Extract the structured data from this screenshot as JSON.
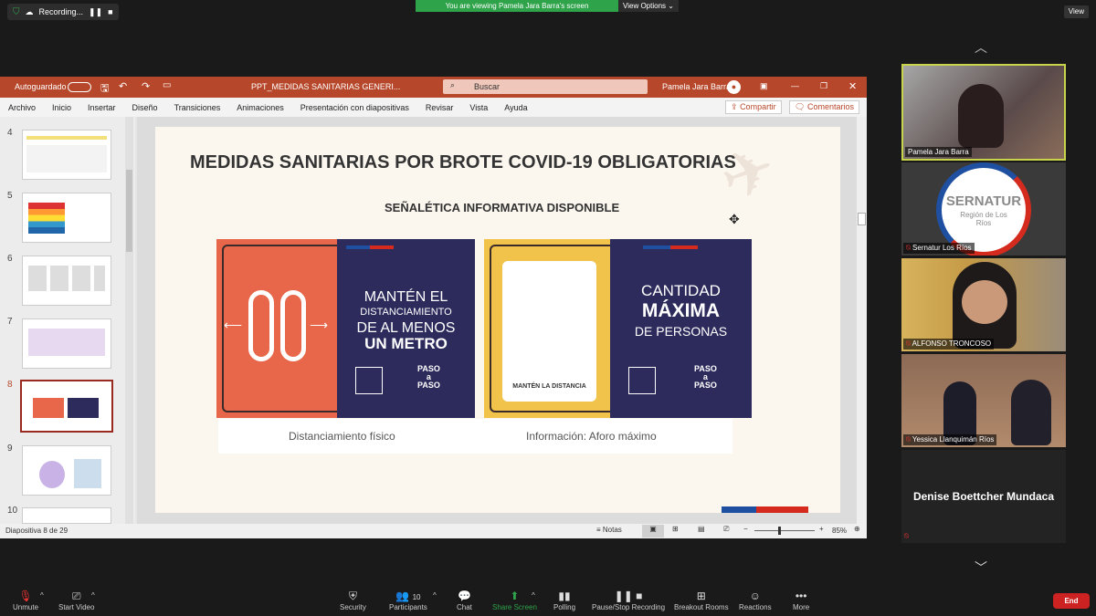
{
  "top": {
    "recording_label": "Recording...",
    "banner_text": "You are viewing Pamela Jara Barra's screen",
    "view_options_label": "View Options ⌄",
    "view_button_label": "View"
  },
  "ppt": {
    "autosave_label": "Autoguardado",
    "file_title": "PPT_MEDIDAS SANITARIAS GENERI...",
    "search_placeholder": "Buscar",
    "user_name": "Pamela Jara Barra",
    "tabs": [
      "Archivo",
      "Inicio",
      "Insertar",
      "Diseño",
      "Transiciones",
      "Animaciones",
      "Presentación con diapositivas",
      "Revisar",
      "Vista",
      "Ayuda"
    ],
    "share_label": "Compartir",
    "comments_label": "Comentarios",
    "thumb_numbers": [
      "4",
      "5",
      "6",
      "7",
      "8",
      "9",
      "10"
    ],
    "status_slide": "Diapositiva 8 de 29",
    "status_notes": "Notas",
    "zoom_label": "85%"
  },
  "slide": {
    "title": "MEDIDAS SANITARIAS POR BROTE COVID-19 OBLIGATORIAS",
    "subtitle": "SEÑALÉTICA INFORMATIVA DISPONIBLE",
    "card1_line1": "MANTÉN EL",
    "card1_line2": "DISTANCIAMIENTO",
    "card1_line3": "DE AL MENOS",
    "card1_line4": "UN METRO",
    "card2_line1": "CANTIDAD",
    "card2_line2": "MÁXIMA",
    "card2_line3": "DE PERSONAS",
    "card2_inner_label": "MANTÉN LA DISTANCIA",
    "paso_line1": "PASO",
    "paso_line2": "a",
    "paso_line3": "PASO",
    "caption1": "Distanciamiento físico",
    "caption2": "Información: Aforo máximo"
  },
  "participants": [
    {
      "name": "Pamela Jara Barra"
    },
    {
      "name": "Sernatur Los Ríos",
      "logo_text": "SERNATUR",
      "logo_sub": "Región de Los Ríos"
    },
    {
      "name": "ALFONSO TRONCOSO"
    },
    {
      "name": "Yessica Llanquimán Ríos"
    },
    {
      "name": "Denise Boettcher Mundaca"
    }
  ],
  "bottom": {
    "unmute": "Unmute",
    "start_video": "Start Video",
    "security": "Security",
    "participants": "Participants",
    "participants_count": "10",
    "chat": "Chat",
    "share_screen": "Share Screen",
    "polling": "Polling",
    "pause_recording": "Pause/Stop Recording",
    "breakout": "Breakout Rooms",
    "reactions": "Reactions",
    "more": "More",
    "end": "End"
  }
}
